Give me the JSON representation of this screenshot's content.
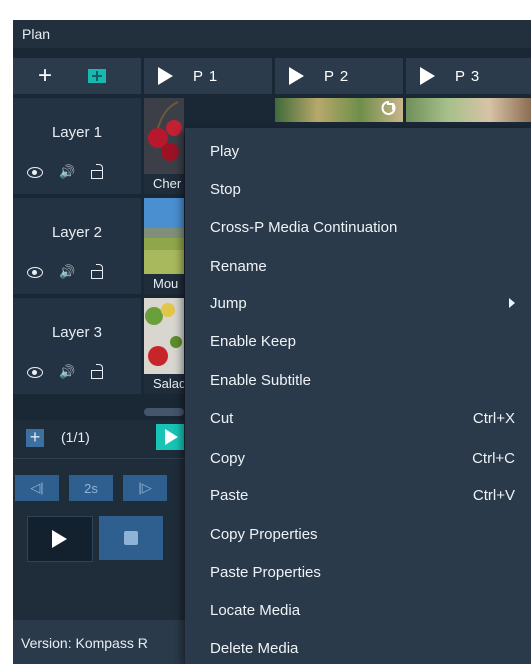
{
  "window": {
    "title": "Plan"
  },
  "header": {
    "add_label": "+",
    "pages": [
      {
        "label": "P 1"
      },
      {
        "label": "P 2"
      },
      {
        "label": "P 3"
      }
    ]
  },
  "layers": [
    {
      "name": "Layer 1",
      "media": "Cher",
      "audio": "🔊"
    },
    {
      "name": "Layer 2",
      "media": "Mou",
      "audio": "🔊"
    },
    {
      "name": "Layer 3",
      "media": "Salad",
      "audio": "🔊"
    }
  ],
  "controls": {
    "add_page": "+",
    "pager": "(1/1)",
    "prev_label": "◁|",
    "interval": "2s",
    "next_label": "|▷"
  },
  "footer": {
    "version": "Version: Kompass R"
  },
  "context_menu": {
    "items": [
      {
        "label": "Play",
        "shortcut": ""
      },
      {
        "label": "Stop",
        "shortcut": ""
      },
      {
        "label": "Cross-P Media Continuation",
        "shortcut": ""
      },
      {
        "label": "Rename",
        "shortcut": ""
      },
      {
        "label": "Jump",
        "shortcut": ""
      },
      {
        "label": "Enable Keep",
        "shortcut": ""
      },
      {
        "label": "Enable Subtitle",
        "shortcut": ""
      },
      {
        "label": "Cut",
        "shortcut": "Ctrl+X"
      },
      {
        "label": "Copy",
        "shortcut": "Ctrl+C"
      },
      {
        "label": "Paste",
        "shortcut": "Ctrl+V"
      },
      {
        "label": "Copy Properties",
        "shortcut": ""
      },
      {
        "label": "Paste Properties",
        "shortcut": ""
      },
      {
        "label": "Locate Media",
        "shortcut": ""
      },
      {
        "label": "Delete Media",
        "shortcut": ""
      }
    ]
  },
  "colors": {
    "background": "#1a2735",
    "panel": "#243343",
    "accent": "#17c4b6",
    "button": "#2f5f8e",
    "menu": "#2b3a4a"
  }
}
